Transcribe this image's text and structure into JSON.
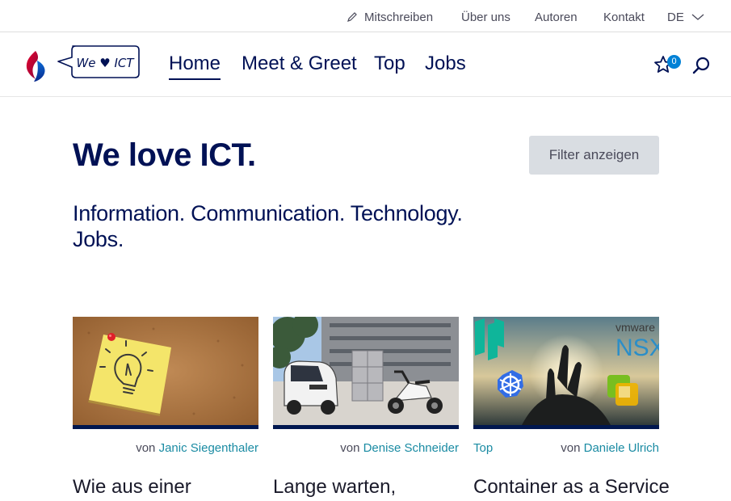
{
  "utility_nav": {
    "write": "Mitschreiben",
    "about": "Über uns",
    "authors": "Autoren",
    "contact": "Kontakt",
    "language": "DE"
  },
  "logo": {
    "bubble_text": "We ♥ ICT"
  },
  "main_nav": {
    "items": [
      "Home",
      "Meet & Greet",
      "Top",
      "Jobs"
    ],
    "active": "Home"
  },
  "favorites": {
    "count": "0"
  },
  "hero": {
    "title": "We love ICT.",
    "subtitle": "Information. Communication. Technology. Jobs.",
    "filter_button": "Filter anzeigen"
  },
  "cards": [
    {
      "category": "",
      "by": "von",
      "author": "Janic Siegenthaler",
      "title": "Wie aus einer",
      "image": "lightbulb-note"
    },
    {
      "category": "",
      "by": "von",
      "author": "Denise Schneider",
      "title": "Lange warten,",
      "image": "electric-vehicles"
    },
    {
      "category": "Top",
      "by": "von",
      "author": "Daniele Ulrich",
      "title": "Container as a Service",
      "image": "container-logos",
      "image_text": [
        "vmware",
        "NSX"
      ]
    }
  ],
  "colors": {
    "brand_navy": "#001155",
    "link_teal": "#1a8ba3",
    "badge_blue": "#0081d6",
    "button_grey": "#d9dde2"
  }
}
